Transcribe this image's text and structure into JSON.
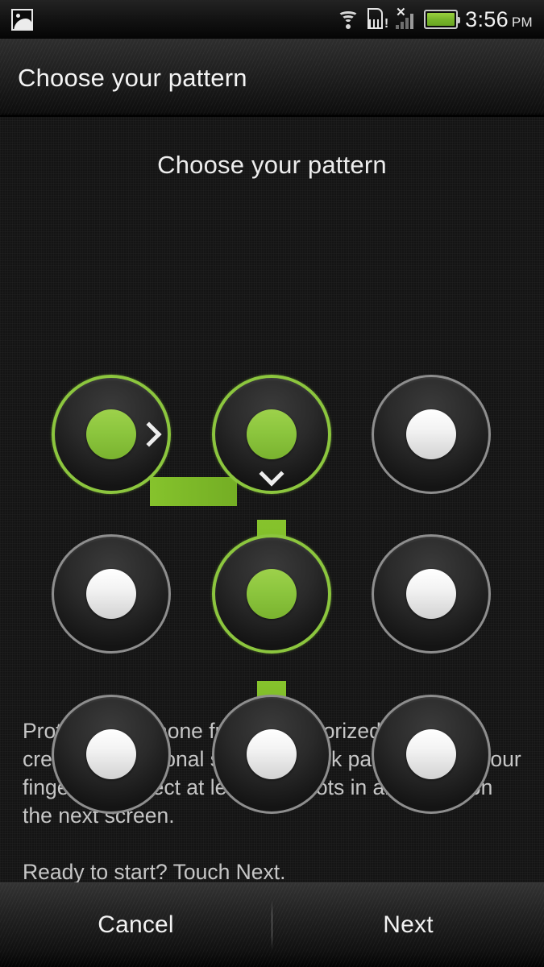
{
  "statusbar": {
    "app_icon": "gallery-icon",
    "wifi_icon": "wifi-icon",
    "sdcard_icon": "sdcard-warning-icon",
    "signal_icon": "signal-no-service-icon",
    "battery_icon": "battery-icon",
    "time": "3:56",
    "ampm": "PM"
  },
  "actionbar": {
    "title": "Choose your pattern"
  },
  "content": {
    "heading": "Choose your pattern",
    "description": [
      "Protect your phone from unauthorized use by creating a personal screen unlock pattern. Slide your finger to connect at least four dots in any order on the next screen.",
      "Ready to start? Touch Next."
    ]
  },
  "pattern": {
    "rows": 3,
    "cols": 3,
    "accent_color": "#8cc63e",
    "line_color": "#7cb828",
    "inactive_ring_color": "#8e8e8e",
    "inactive_core_color": "#f3f3f3",
    "dots": [
      {
        "id": "dot-1",
        "row": 0,
        "col": 0,
        "state": "selected",
        "arrow": "right"
      },
      {
        "id": "dot-2",
        "row": 0,
        "col": 1,
        "state": "selected",
        "arrow": "down"
      },
      {
        "id": "dot-3",
        "row": 0,
        "col": 2,
        "state": "empty",
        "arrow": "none"
      },
      {
        "id": "dot-4",
        "row": 1,
        "col": 0,
        "state": "empty",
        "arrow": "none"
      },
      {
        "id": "dot-5",
        "row": 1,
        "col": 1,
        "state": "selected",
        "arrow": "none"
      },
      {
        "id": "dot-6",
        "row": 1,
        "col": 2,
        "state": "empty",
        "arrow": "none"
      },
      {
        "id": "dot-7",
        "row": 2,
        "col": 0,
        "state": "empty",
        "arrow": "none"
      },
      {
        "id": "dot-8",
        "row": 2,
        "col": 1,
        "state": "empty",
        "arrow": "none"
      },
      {
        "id": "dot-9",
        "row": 2,
        "col": 2,
        "state": "empty",
        "arrow": "none"
      }
    ],
    "path": [
      "dot-1",
      "dot-2",
      "dot-5"
    ],
    "trailing_stub": true
  },
  "buttonbar": {
    "cancel_label": "Cancel",
    "next_label": "Next"
  }
}
